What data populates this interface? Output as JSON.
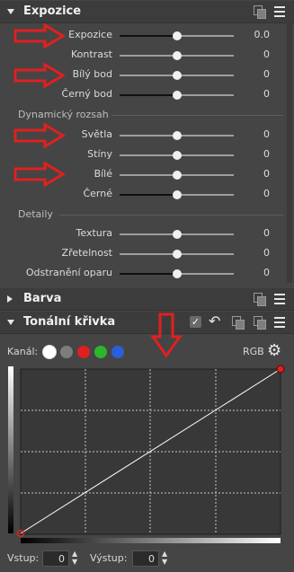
{
  "exposure": {
    "title": "Expozice",
    "rows": [
      {
        "label": "Expozice",
        "value": "0.0"
      },
      {
        "label": "Kontrast",
        "value": "0"
      },
      {
        "label": "Bílý bod",
        "value": "0"
      },
      {
        "label": "Černý bod",
        "value": "0"
      }
    ],
    "dynamic_title": "Dynamický rozsah",
    "dynamic_rows": [
      {
        "label": "Světla",
        "value": "0"
      },
      {
        "label": "Stíny",
        "value": "0"
      },
      {
        "label": "Bílé",
        "value": "0"
      },
      {
        "label": "Černé",
        "value": "0"
      }
    ],
    "details_title": "Detaily",
    "details_rows": [
      {
        "label": "Textura",
        "value": "0"
      },
      {
        "label": "Zřetelnost",
        "value": "0"
      },
      {
        "label": "Odstranění oparu",
        "value": "0"
      }
    ]
  },
  "color": {
    "title": "Barva"
  },
  "curve": {
    "title": "Tonální křivka",
    "checkbox_mark": "✓",
    "undo_glyph": "↶",
    "channel_label": "Kanál:",
    "channels": [
      "white",
      "gray",
      "red",
      "green",
      "blue"
    ],
    "channel_colors": {
      "white": "#ffffff",
      "gray": "#7d7d7d",
      "red": "#e02020",
      "green": "#2db52d",
      "blue": "#2b5fd9"
    },
    "rgb_label": "RGB",
    "gear_glyph": "⚙",
    "input_label": "Vstup:",
    "input_value": "0",
    "output_label": "Výstup:",
    "output_value": "0"
  },
  "colors": {
    "arrow": "#e02020",
    "panel_bg": "#454545",
    "header_bg": "#3c3c3c",
    "curve_bg": "#383838"
  }
}
